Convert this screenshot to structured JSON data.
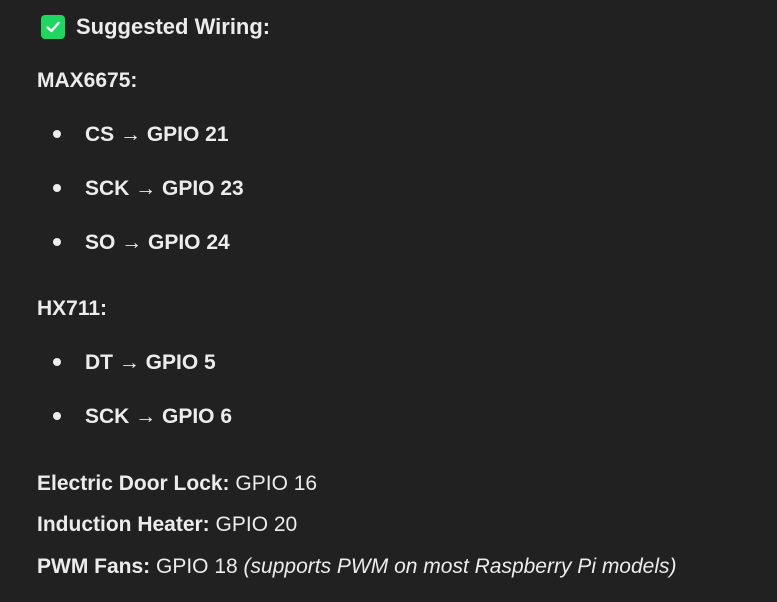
{
  "title": "Suggested Wiring:",
  "sections": [
    {
      "heading": "MAX6675:",
      "items": [
        "CS → GPIO 21",
        "SCK → GPIO 23",
        "SO → GPIO 24"
      ]
    },
    {
      "heading": "HX711:",
      "items": [
        "DT → GPIO 5",
        "SCK → GPIO 6"
      ]
    }
  ],
  "lines": [
    {
      "label": "Electric Door Lock:",
      "value": " GPIO 16"
    },
    {
      "label": "Induction Heater:",
      "value": " GPIO 20"
    },
    {
      "label": "PWM Fans:",
      "value": " GPIO 18 ",
      "note": "(supports PWM on most Raspberry Pi models)"
    }
  ]
}
